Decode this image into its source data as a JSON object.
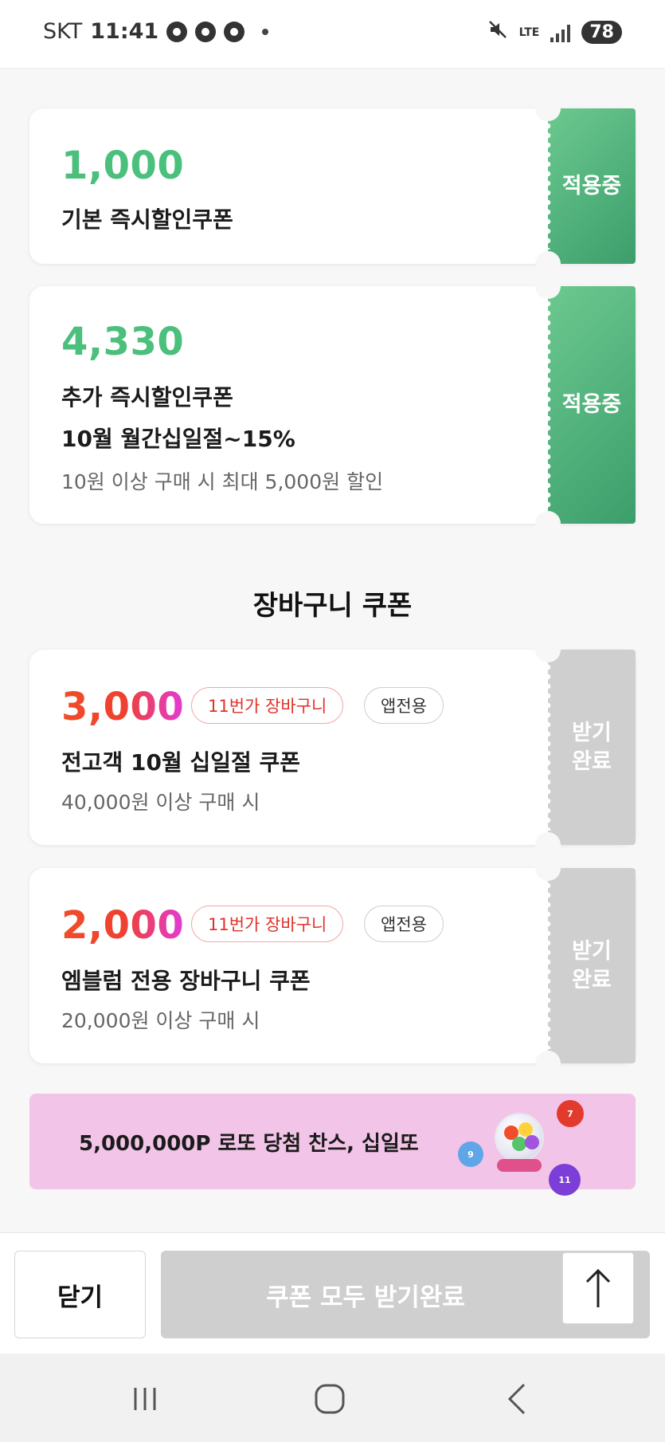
{
  "status_bar": {
    "carrier": "SKT",
    "time": "11:41",
    "network": "LTE",
    "battery": "78"
  },
  "applied_coupons": [
    {
      "amount": "1,000",
      "title": "기본 즉시할인쿠폰",
      "status": "적용중"
    },
    {
      "amount": "4,330",
      "title": "추가 즉시할인쿠폰",
      "subtitle": "10월 월간십일절~15%",
      "condition": "10원 이상 구매 시 최대 5,000원 할인",
      "status": "적용중"
    }
  ],
  "cart_section": {
    "title": "장바구니 쿠폰",
    "coupons": [
      {
        "amount": "3,000",
        "tag_cart": "11번가 장바구니",
        "tag_app": "앱전용",
        "title": "전고객 10월 십일절 쿠폰",
        "condition": "40,000원 이상 구매 시",
        "status_line1": "받기",
        "status_line2": "완료"
      },
      {
        "amount": "2,000",
        "tag_cart": "11번가 장바구니",
        "tag_app": "앱전용",
        "title": "엠블럼 전용 장바구니 쿠폰",
        "condition": "20,000원 이상 구매 시",
        "status_line1": "받기",
        "status_line2": "완료"
      }
    ]
  },
  "lotto_banner": {
    "text": "5,000,000P 로또 당첨 찬스, 십일또",
    "ball_numbers": [
      "9",
      "11",
      "7"
    ]
  },
  "bottom_bar": {
    "close_label": "닫기",
    "receive_all_label": "쿠폰 모두 받기완료"
  },
  "colors": {
    "applied_green": "#4bbf7c",
    "disabled_gray": "#cfcfcf",
    "banner_pink": "#f2c4e7",
    "tag_red": "#e0322a"
  },
  "icons": [
    "mute-icon",
    "signal-icon",
    "battery-icon",
    "arrow-up-icon",
    "recents-icon",
    "home-icon",
    "back-icon"
  ]
}
